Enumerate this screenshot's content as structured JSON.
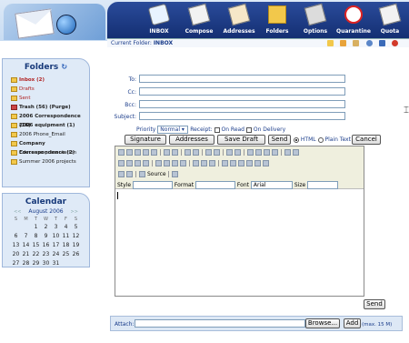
{
  "nav": {
    "items": [
      {
        "label": "INBOX",
        "icon": "inbox-icon"
      },
      {
        "label": "Compose",
        "icon": "compose-icon"
      },
      {
        "label": "Addresses",
        "icon": "addresses-icon"
      },
      {
        "label": "Folders",
        "icon": "folders-icon"
      },
      {
        "label": "Options",
        "icon": "options-icon"
      },
      {
        "label": "Quarantine",
        "icon": "quarantine-icon"
      },
      {
        "label": "Quota",
        "icon": "quota-icon"
      }
    ]
  },
  "folderbar": {
    "label": "Current Folder:",
    "value": "INBOX"
  },
  "folders": {
    "title": "Folders",
    "items": [
      {
        "label": "Inbox (2)",
        "style": "red-bold"
      },
      {
        "label": "Drafts",
        "style": "red"
      },
      {
        "label": "Sent",
        "style": "red"
      },
      {
        "label": "Trash (56)  (Purge)",
        "style": "bold"
      },
      {
        "label": "2006 Correspondence (16)",
        "style": "bold"
      },
      {
        "label": "2006 equipment (1)",
        "style": "bold"
      },
      {
        "label": "2006 Phone_Email",
        "style": "normal"
      },
      {
        "label": "Company Correspondence (2)",
        "style": "bold"
      },
      {
        "label": "Educause presentation",
        "style": "normal"
      },
      {
        "label": "Summer 2006 projects",
        "style": "normal"
      }
    ]
  },
  "calendar": {
    "title": "Calendar",
    "nav_prev": "<<",
    "nav_next": ">>",
    "month": "August 2006",
    "dow": [
      "S",
      "M",
      "T",
      "W",
      "T",
      "F",
      "S"
    ],
    "weeks": [
      [
        "",
        "",
        "1",
        "2",
        "3",
        "4",
        "5"
      ],
      [
        "6",
        "7",
        "8",
        "9",
        "10",
        "11",
        "12"
      ],
      [
        "13",
        "14",
        "15",
        "16",
        "17",
        "18",
        "19"
      ],
      [
        "20",
        "21",
        "22",
        "23",
        "24",
        "25",
        "26"
      ],
      [
        "27",
        "28",
        "29",
        "30",
        "31",
        "",
        ""
      ]
    ]
  },
  "compose": {
    "to_label": "To:",
    "cc_label": "Cc:",
    "bcc_label": "Bcc:",
    "subject_label": "Subject:",
    "to_value": "",
    "cc_value": "",
    "bcc_value": "",
    "subject_value": "",
    "priority_label": "Priority",
    "priority_value": "Normal",
    "receipt_label": "Receipt:",
    "on_read_label": "On Read",
    "on_delivery_label": "On Delivery",
    "html_label": "HTML",
    "plain_label": "Plain Text",
    "buttons": {
      "signature": "Signature",
      "addresses": "Addresses",
      "save_draft": "Save Draft",
      "send": "Send",
      "cancel": "Cancel",
      "send_bottom": "Send"
    }
  },
  "editor": {
    "source_label": "Source",
    "style_label": "Style",
    "format_label": "Format",
    "font_label": "Font",
    "font_value": "Arial",
    "size_label": "Size"
  },
  "attach": {
    "label": "Attach:",
    "browse": "Browse...",
    "add": "Add",
    "max": "(max. 15 M)"
  }
}
